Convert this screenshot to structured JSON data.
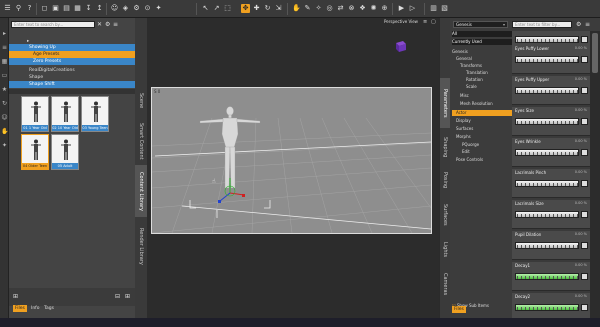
{
  "left_panel": {
    "search_placeholder": "Enter text to search by...",
    "tree": [
      "Showing Up",
      "Age Presets",
      "Zero Presets",
      "RealDigitalCreations",
      "Shape",
      "Shape Shift"
    ],
    "page_indicator": "1 of 1",
    "thumbnails": [
      {
        "label": "01 1 Year Old",
        "selected": false
      },
      {
        "label": "02 10 Year Old",
        "selected": false
      },
      {
        "label": "03 Young Teen",
        "selected": false
      },
      {
        "label": "04 Older Teen",
        "selected": true
      },
      {
        "label": "05 Adult",
        "selected": false
      }
    ],
    "side_tabs": [
      "Scene",
      "Smart Content",
      "Content Library",
      "Render Library"
    ],
    "bottom_tabs": [
      "Files",
      "Info",
      "Tags"
    ]
  },
  "viewport": {
    "view_label": "Perspective View",
    "corner_label": "S 0"
  },
  "right_panel": {
    "dropdown": "Genesis",
    "search_placeholder": "Enter text to filter by...",
    "filters": [
      "All",
      "Currently Used"
    ],
    "tree": [
      "Genesis",
      "General",
      "Transforms",
      "Translation",
      "Rotation",
      "Scale",
      "Misc",
      "Mesh Resolution",
      "Actor",
      "Display",
      "Surfaces",
      "Morphs",
      "PQuorge",
      "Edit",
      "Pose Controls"
    ],
    "side_tabs": [
      "Parameters",
      "Shaping",
      "Posing",
      "Surfaces",
      "Lights",
      "Cameras"
    ],
    "show_sub_items": "Show Sub Items",
    "bottom_tab": "Files",
    "sliders": [
      {
        "name": "Eyes Height Outer",
        "value": "0.00 %"
      },
      {
        "name": "Eyes Puffy Lower",
        "value": "0.00 %"
      },
      {
        "name": "Eyes Puffy Upper",
        "value": "0.00 %"
      },
      {
        "name": "Eyes Size",
        "value": "0.00 %"
      },
      {
        "name": "Eyes Wrinkle",
        "value": "0.00 %"
      },
      {
        "name": "Lacrimals Pinch",
        "value": "0.00 %"
      },
      {
        "name": "Lacrimals Size",
        "value": "0.00 %"
      },
      {
        "name": "Pupil Dilation",
        "value": "0.00 %"
      },
      {
        "name": "Decay1",
        "value": "0.00 %"
      },
      {
        "name": "Decay2",
        "value": "0.00 %"
      }
    ]
  },
  "colors": {
    "accent": "#f0a020",
    "selection": "#3a86c8",
    "slider_active": "#49c03a"
  }
}
